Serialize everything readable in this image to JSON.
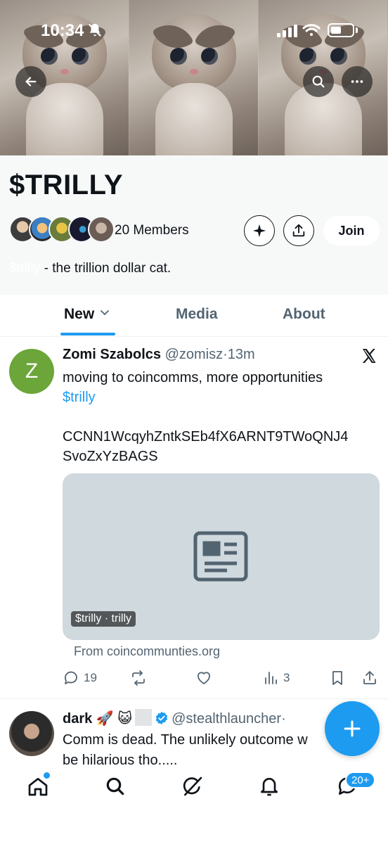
{
  "status_bar": {
    "time": "10:34"
  },
  "community": {
    "name": "$TRILLY",
    "members_label": "20 Members",
    "join_label": "Join",
    "description_tag": "$trilly",
    "description_text": " - the trillion dollar cat."
  },
  "tabs": [
    {
      "label": "New",
      "active": true
    },
    {
      "label": "Media",
      "active": false
    },
    {
      "label": "About",
      "active": false
    }
  ],
  "posts": [
    {
      "avatar_letter": "Z",
      "avatar_color": "#6ca53a",
      "name": "Zomi Szabolcs",
      "handle": "@zomisz",
      "time": "13m",
      "text_line1": "moving to coincomms, more opportunities",
      "cashtag": "$trilly",
      "address_line1": "CCNN1WcqyhZntkSEb4fX6ARNT9TWoQNJ4",
      "address_line2": "SvoZxYzBAGS",
      "card_label": "$trilly · trilly",
      "card_source": "From coincommunties.org",
      "replies": "19",
      "views": "3"
    },
    {
      "name": "dark 🚀 😺",
      "handle": "@stealthlauncher",
      "separator": "·",
      "text": "Comm is dead. The unlikely outcome w",
      "text_line2": "be hilarious tho....."
    }
  ],
  "nav": {
    "messages_badge": "20+"
  },
  "colors": {
    "accent": "#1d9bf0",
    "text": "#0f1419",
    "muted": "#536471",
    "header_bg": "#f7f9f9"
  }
}
